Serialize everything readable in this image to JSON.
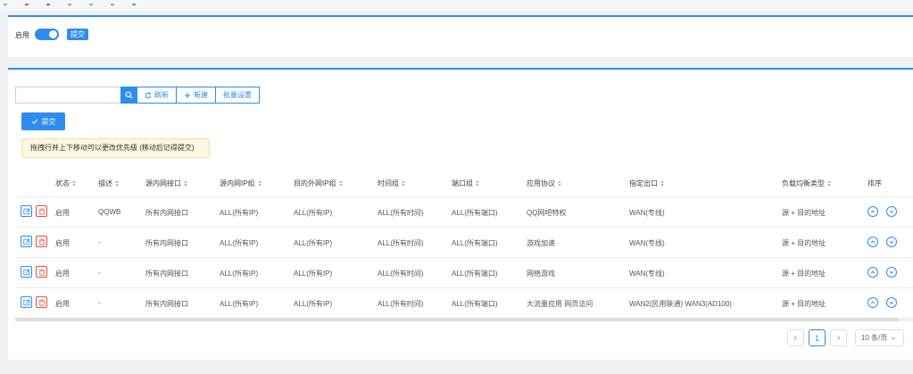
{
  "top_panel": {
    "enable_label": "启用",
    "enable_on": true,
    "submit_label": "提交"
  },
  "toolbar": {
    "search_placeholder": "",
    "refresh_label": "刷新",
    "new_label": "新建",
    "batch_label": "批量设置",
    "submit_label": "提交"
  },
  "tip": "拖拽行并上下移动可以更改优先级 (移动后记得提交)",
  "columns": [
    "状态",
    "描述",
    "源内网接口",
    "源内网IP组",
    "目的外网IP组",
    "时间组",
    "端口组",
    "应用协议",
    "指定出口",
    "负载均衡类型",
    "排序"
  ],
  "rows": [
    {
      "status": "启用",
      "desc": "QQWB",
      "src_if": "所有内网接口",
      "src_ip": "ALL(所有IP)",
      "dst_ip": "ALL(所有IP)",
      "time": "ALL(所有时间)",
      "port": "ALL(所有端口)",
      "app": "QQ网吧特权",
      "egress": "WAN(专线)",
      "lb": "源 + 目的地址"
    },
    {
      "status": "启用",
      "desc": "-",
      "src_if": "所有内网接口",
      "src_ip": "ALL(所有IP)",
      "dst_ip": "ALL(所有IP)",
      "time": "ALL(所有时间)",
      "port": "ALL(所有端口)",
      "app": "游戏加速",
      "egress": "WAN(专线)",
      "lb": "源 + 目的地址"
    },
    {
      "status": "启用",
      "desc": "-",
      "src_if": "所有内网接口",
      "src_ip": "ALL(所有IP)",
      "dst_ip": "ALL(所有IP)",
      "time": "ALL(所有时间)",
      "port": "ALL(所有端口)",
      "app": "网络游戏",
      "egress": "WAN(专线)",
      "lb": "源 + 目的地址"
    },
    {
      "status": "启用",
      "desc": "-",
      "src_if": "所有内网接口",
      "src_ip": "ALL(所有IP)",
      "dst_ip": "ALL(所有IP)",
      "time": "ALL(所有时间)",
      "port": "ALL(所有端口)",
      "app": "大流量应用 网页访问",
      "egress": "WAN2(民用联通) WAN3(AD100)",
      "lb": "源 + 目的地址"
    }
  ],
  "pagination": {
    "current_page": "1",
    "page_size": "10 条/页"
  },
  "colors": {
    "accent": "#2d8cf0",
    "danger": "#e54d42",
    "tip_bg": "#fdf6e3"
  },
  "icons": [
    "search-icon",
    "refresh-icon",
    "plus-icon",
    "check-icon",
    "edit-icon",
    "delete-icon",
    "chevron-up-icon",
    "chevron-down-icon",
    "chevron-left-icon",
    "chevron-right-icon"
  ]
}
